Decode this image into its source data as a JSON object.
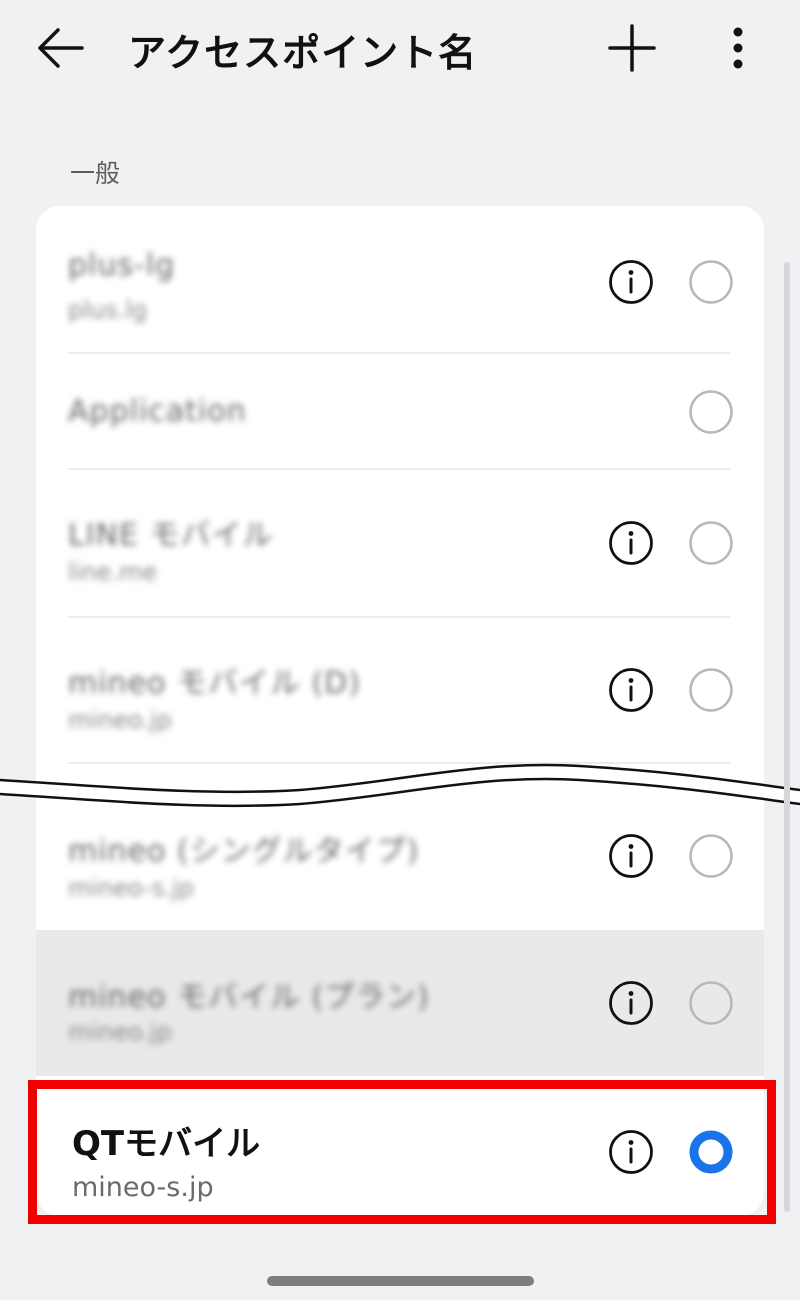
{
  "header": {
    "title": "アクセスポイント名",
    "back_icon": "arrow-left-icon",
    "add_icon": "plus-icon",
    "more_icon": "more-vert-icon"
  },
  "section": {
    "label": "一般"
  },
  "apn_list": [
    {
      "name": "plus-lg",
      "sub": "plus.lg",
      "has_info": true,
      "selected": false
    },
    {
      "name": "Application",
      "sub": "",
      "has_info": false,
      "selected": false
    },
    {
      "name": "LINE モバイル",
      "sub": "line.me",
      "has_info": true,
      "selected": false
    },
    {
      "name": "mineo モバイル (D)",
      "sub": "mineo.jp",
      "has_info": true,
      "selected": false
    },
    {
      "name": "mineo (シングルタイプ)",
      "sub": "mineo-s.jp",
      "has_info": true,
      "selected": false
    },
    {
      "name": "mineo モバイル (プラン)",
      "sub": "mineo.jp",
      "has_info": true,
      "selected": false,
      "pressed": true
    },
    {
      "name": "QTモバイル",
      "sub": "mineo-s.jp",
      "has_info": true,
      "selected": true
    }
  ],
  "colors": {
    "background": "#f0f1f3",
    "card": "#ffffff",
    "accent_radio": "#1a73e8",
    "highlight_border": "#f20000",
    "text_primary": "#111111",
    "text_secondary": "#6b6b6b"
  }
}
